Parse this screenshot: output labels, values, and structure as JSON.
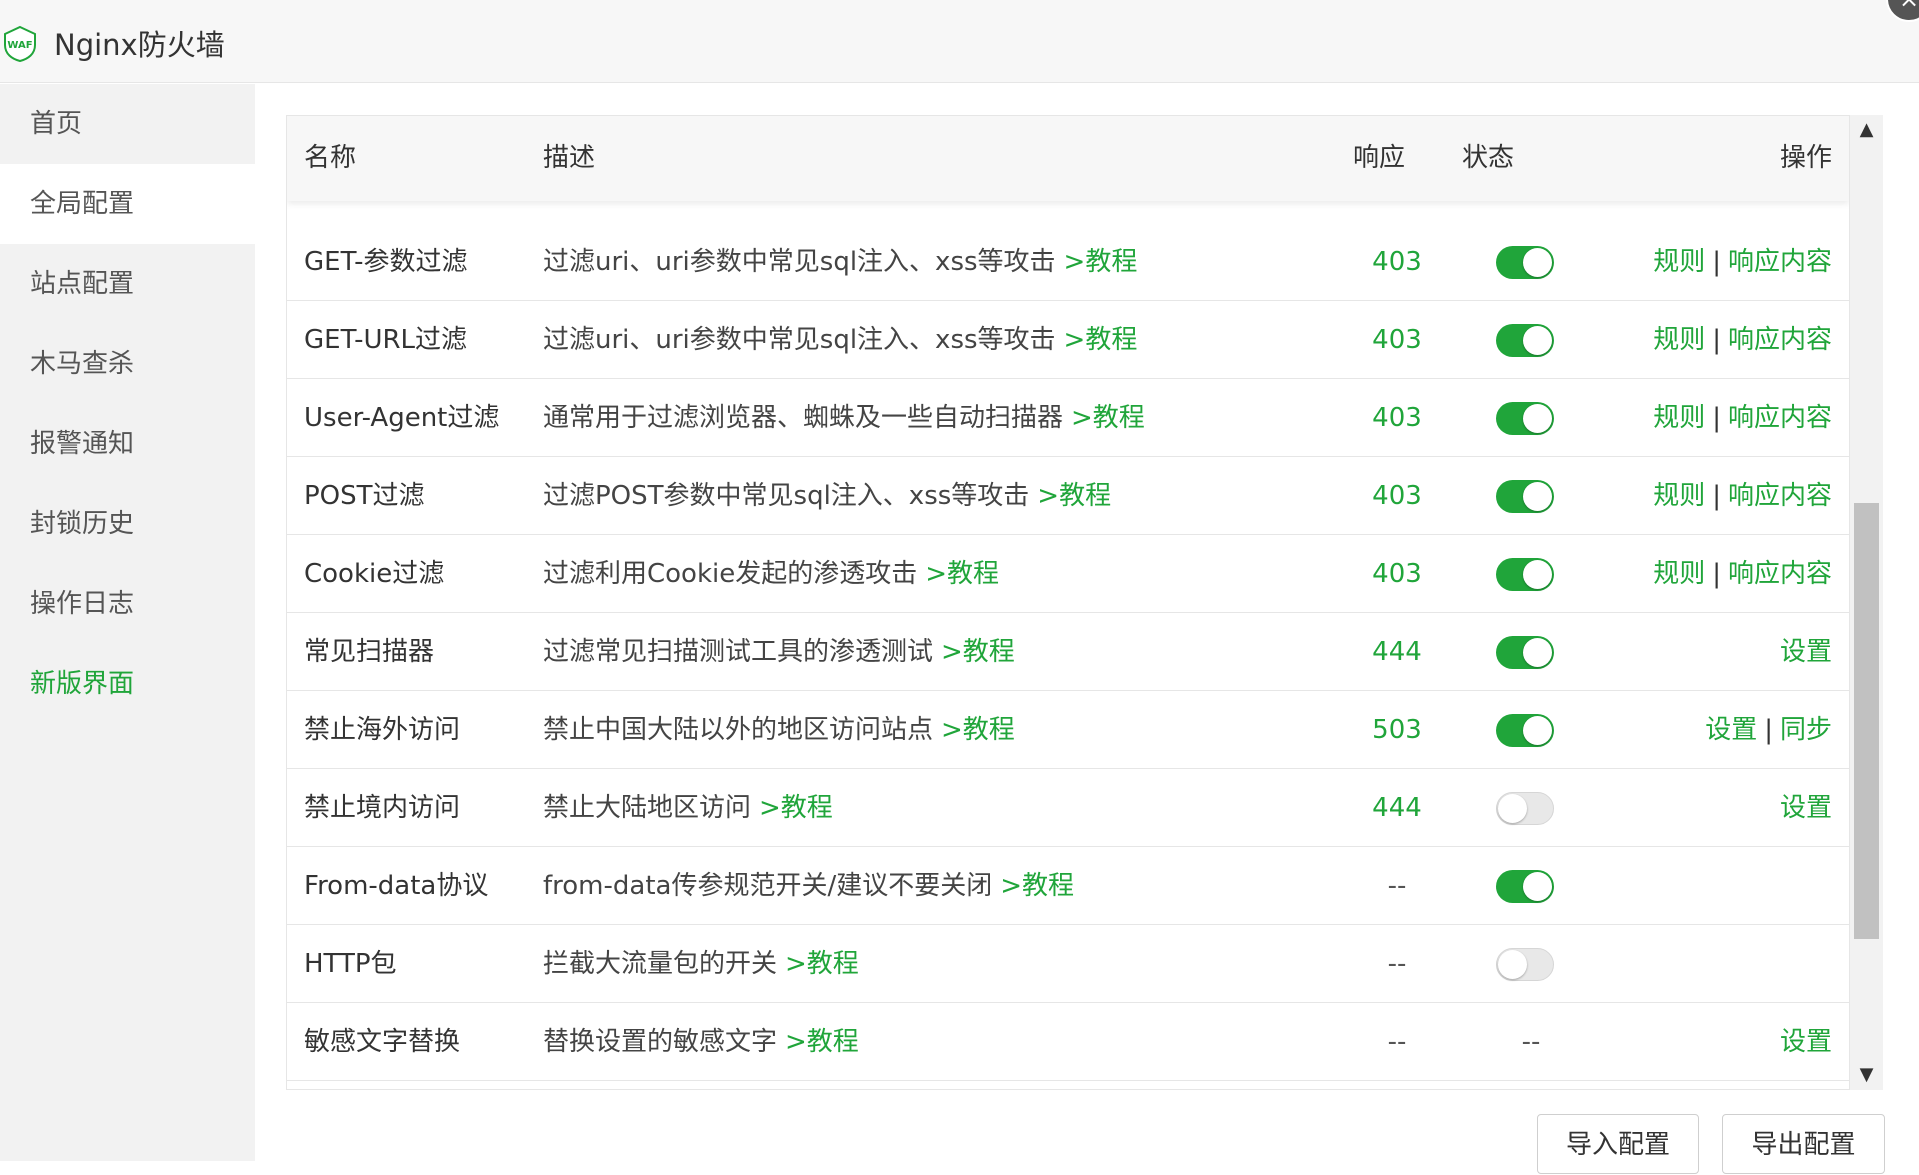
{
  "app": {
    "title": "Nginx防火墙",
    "logo_text": "WAF",
    "close_icon": "×"
  },
  "sidebar": {
    "items": [
      {
        "label": "首页"
      },
      {
        "label": "全局配置"
      },
      {
        "label": "站点配置"
      },
      {
        "label": "木马查杀"
      },
      {
        "label": "报警通知"
      },
      {
        "label": "封锁历史"
      },
      {
        "label": "操作日志"
      },
      {
        "label": "新版界面"
      }
    ],
    "active_index": 1
  },
  "table": {
    "headers": {
      "name": "名称",
      "desc": "描述",
      "resp": "响应",
      "state": "状态",
      "ops": "操作"
    },
    "rows": [
      {
        "name": "GET-参数过滤",
        "desc": "过滤uri、uri参数中常见sql注入、xss等攻击",
        "tutorial": ">教程",
        "resp": "403",
        "state": "on",
        "ops": [
          "规则",
          "响应内容"
        ]
      },
      {
        "name": "GET-URL过滤",
        "desc": "过滤uri、uri参数中常见sql注入、xss等攻击",
        "tutorial": ">教程",
        "resp": "403",
        "state": "on",
        "ops": [
          "规则",
          "响应内容"
        ]
      },
      {
        "name": "User-Agent过滤",
        "desc": "通常用于过滤浏览器、蜘蛛及一些自动扫描器",
        "tutorial": ">教程",
        "resp": "403",
        "state": "on",
        "ops": [
          "规则",
          "响应内容"
        ]
      },
      {
        "name": "POST过滤",
        "desc": "过滤POST参数中常见sql注入、xss等攻击",
        "tutorial": ">教程",
        "resp": "403",
        "state": "on",
        "ops": [
          "规则",
          "响应内容"
        ]
      },
      {
        "name": "Cookie过滤",
        "desc": "过滤利用Cookie发起的渗透攻击",
        "tutorial": ">教程",
        "resp": "403",
        "state": "on",
        "ops": [
          "规则",
          "响应内容"
        ]
      },
      {
        "name": "常见扫描器",
        "desc": "过滤常见扫描测试工具的渗透测试",
        "tutorial": ">教程",
        "resp": "444",
        "state": "on",
        "ops": [
          "设置"
        ]
      },
      {
        "name": "禁止海外访问",
        "desc": "禁止中国大陆以外的地区访问站点",
        "tutorial": ">教程",
        "resp": "503",
        "state": "on",
        "ops": [
          "设置",
          "同步"
        ]
      },
      {
        "name": "禁止境内访问",
        "desc": "禁止大陆地区访问",
        "tutorial": ">教程",
        "resp": "444",
        "state": "off",
        "ops": [
          "设置"
        ]
      },
      {
        "name": "From-data协议",
        "desc": "from-data传参规范开关/建议不要关闭",
        "tutorial": ">教程",
        "resp": "--",
        "state": "on",
        "ops": []
      },
      {
        "name": "HTTP包",
        "desc": "拦截大流量包的开关",
        "tutorial": ">教程",
        "resp": "--",
        "state": "off",
        "ops": []
      },
      {
        "name": "敏感文字替换",
        "desc": "替换设置的敏感文字",
        "tutorial": ">教程",
        "resp": "--",
        "state": "--",
        "ops": [
          "设置"
        ]
      }
    ]
  },
  "footer": {
    "import_label": "导入配置",
    "export_label": "导出配置"
  },
  "colors": {
    "accent": "#20a53a",
    "sidebar_bg": "#f2f2f2"
  },
  "scroll": {
    "up_icon": "▲",
    "down_icon": "▼"
  }
}
